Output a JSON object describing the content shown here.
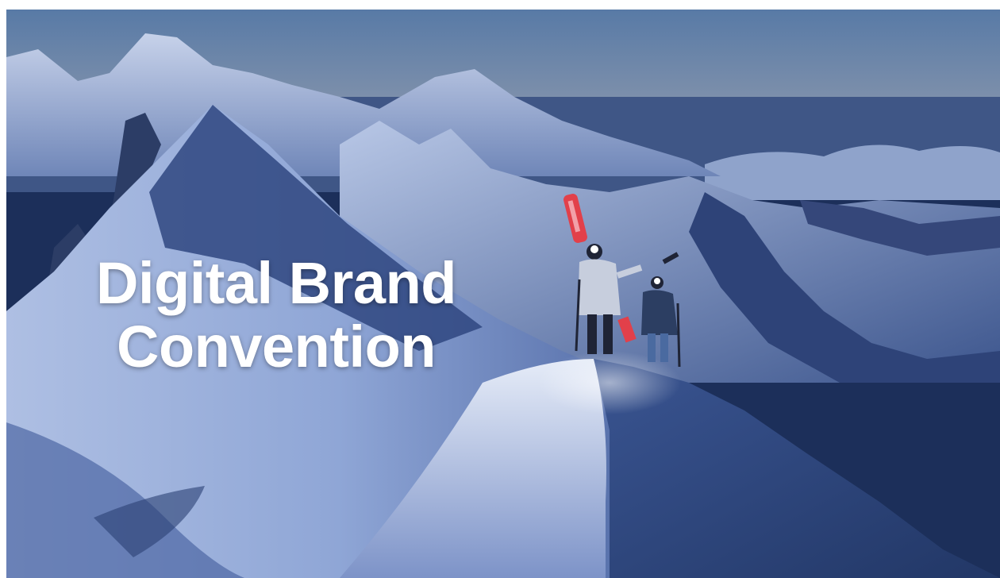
{
  "slide": {
    "title_line_1": "Digital Brand",
    "title_line_2": "Convention"
  },
  "colors": {
    "sky_top": "#5f7fa8",
    "sky_horizon": "#d98a72",
    "snow_light": "#c9d6ee",
    "snow_shadow": "#2a3f73",
    "title_text": "#ffffff",
    "skis_accent": "#e2404a"
  }
}
